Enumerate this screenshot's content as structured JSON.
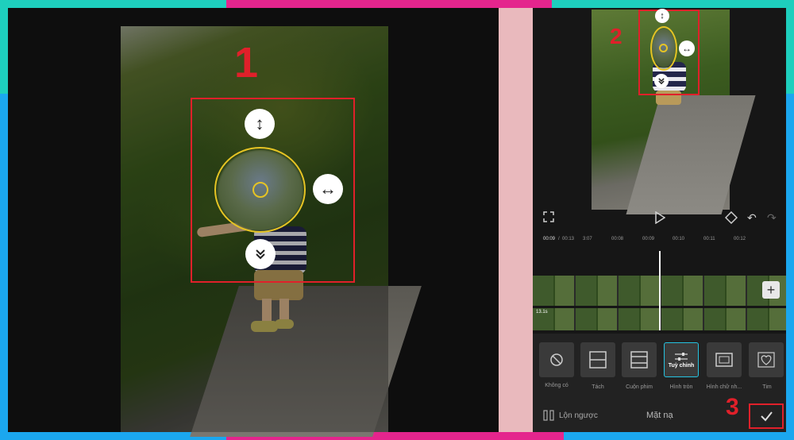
{
  "callouts": [
    "1",
    "2",
    "3"
  ],
  "timeline": {
    "current": "00:09",
    "total": "00:13",
    "ticks": [
      "3:07",
      "00:08",
      "00:09",
      "00:10",
      "00:11",
      "00:12"
    ],
    "clip_duration": "13.1s"
  },
  "mask_options": [
    {
      "label": "Không có",
      "icon": "prohibited-icon"
    },
    {
      "label": "Tách",
      "icon": "split-icon"
    },
    {
      "label": "Cuộn phim",
      "icon": "filmstrip-icon"
    },
    {
      "label": "Hình tròn",
      "icon": "circle-icon",
      "tile_text": "Tuỳ chỉnh",
      "selected": true
    },
    {
      "label": "Hình chữ nh...",
      "icon": "rectangle-icon"
    },
    {
      "label": "Tim",
      "icon": "heart-icon"
    }
  ],
  "bottom_bar": {
    "invert_label": "Lộn ngược",
    "title": "Mặt nạ"
  },
  "colors": {
    "highlight_red": "#e0202a",
    "mask_yellow": "#e6c424",
    "selected_cyan": "#25c2e0"
  }
}
